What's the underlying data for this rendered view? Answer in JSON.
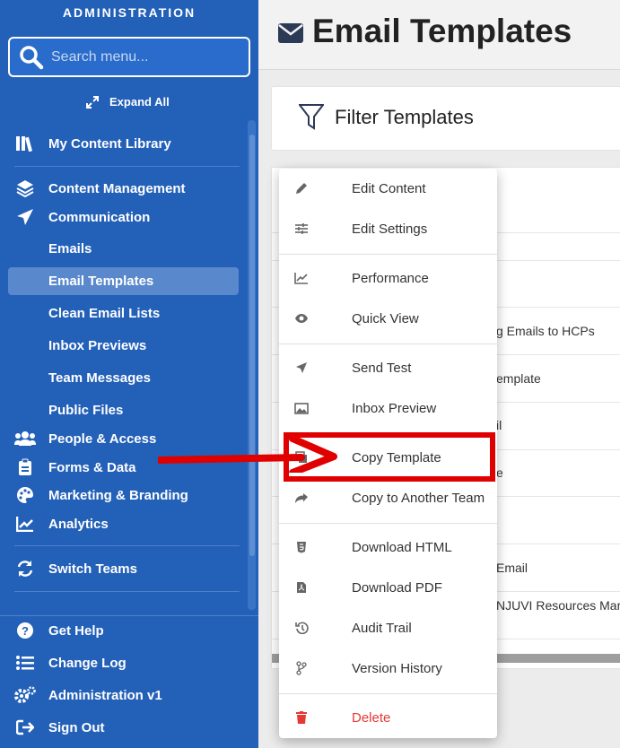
{
  "sidebar": {
    "title": "ADMINISTRATION",
    "search_placeholder": "Search menu...",
    "expand_all": "Expand All",
    "items": {
      "content_library": "My Content Library",
      "content_management": "Content Management",
      "communication": "Communication",
      "emails": "Emails",
      "email_templates": "Email Templates",
      "clean_email_lists": "Clean Email Lists",
      "inbox_previews": "Inbox Previews",
      "team_messages": "Team Messages",
      "public_files": "Public Files",
      "people_access": "People & Access",
      "forms_data": "Forms & Data",
      "marketing_branding": "Marketing & Branding",
      "analytics": "Analytics",
      "switch_teams": "Switch Teams",
      "get_help": "Get Help",
      "change_log": "Change Log",
      "administration_v1": "Administration v1",
      "sign_out": "Sign Out"
    },
    "active_item": "Email Templates"
  },
  "header": {
    "title": "Email Templates"
  },
  "filter": {
    "title": "Filter Templates"
  },
  "table": {
    "visible_cells": [
      "g Emails to HCPs",
      "emplate",
      "il",
      "e",
      "Email",
      "NJUVI Resources Marke"
    ]
  },
  "context_menu": {
    "items": {
      "edit_content": "Edit Content",
      "edit_settings": "Edit Settings",
      "performance": "Performance",
      "quick_view": "Quick View",
      "send_test": "Send Test",
      "inbox_preview": "Inbox Preview",
      "copy_template": "Copy Template",
      "copy_to_team": "Copy to Another Team",
      "download_html": "Download HTML",
      "download_pdf": "Download PDF",
      "audit_trail": "Audit Trail",
      "version_history": "Version History",
      "delete": "Delete"
    },
    "highlighted_item": "Copy Template"
  },
  "colors": {
    "sidebar_bg": "#2360b8",
    "active_item_bg": "#5a88cc",
    "annotation_red": "#e00000",
    "danger": "#e53935"
  }
}
